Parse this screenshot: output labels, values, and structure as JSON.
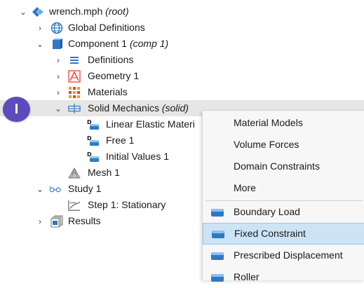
{
  "tree": {
    "root": {
      "name": "wrench.mph",
      "tag": "(root)"
    },
    "global_definitions": "Global Definitions",
    "component": {
      "name": "Component 1",
      "tag": "(comp 1)"
    },
    "definitions": "Definitions",
    "geometry": "Geometry 1",
    "materials": "Materials",
    "solid_mechanics": {
      "name": "Solid Mechanics",
      "tag": "(solid)"
    },
    "linear_elastic": "Linear Elastic Materi",
    "free": "Free 1",
    "initial_values": "Initial Values 1",
    "mesh": "Mesh 1",
    "study": "Study 1",
    "step": "Step 1: Stationary",
    "results": "Results"
  },
  "badge_label": "I",
  "context_menu": {
    "submenus": [
      "Material Models",
      "Volume Forces",
      "Domain Constraints",
      "More"
    ],
    "boundary_items": [
      "Boundary Load",
      "Fixed Constraint",
      "Prescribed Displacement",
      "Roller"
    ],
    "highlighted": "Fixed Constraint"
  },
  "colors": {
    "selected_row": "#e6e6e6",
    "menu_highlight": "#cde4f7",
    "badge": "#5d4bbd",
    "accent_blue": "#2f78c4"
  }
}
